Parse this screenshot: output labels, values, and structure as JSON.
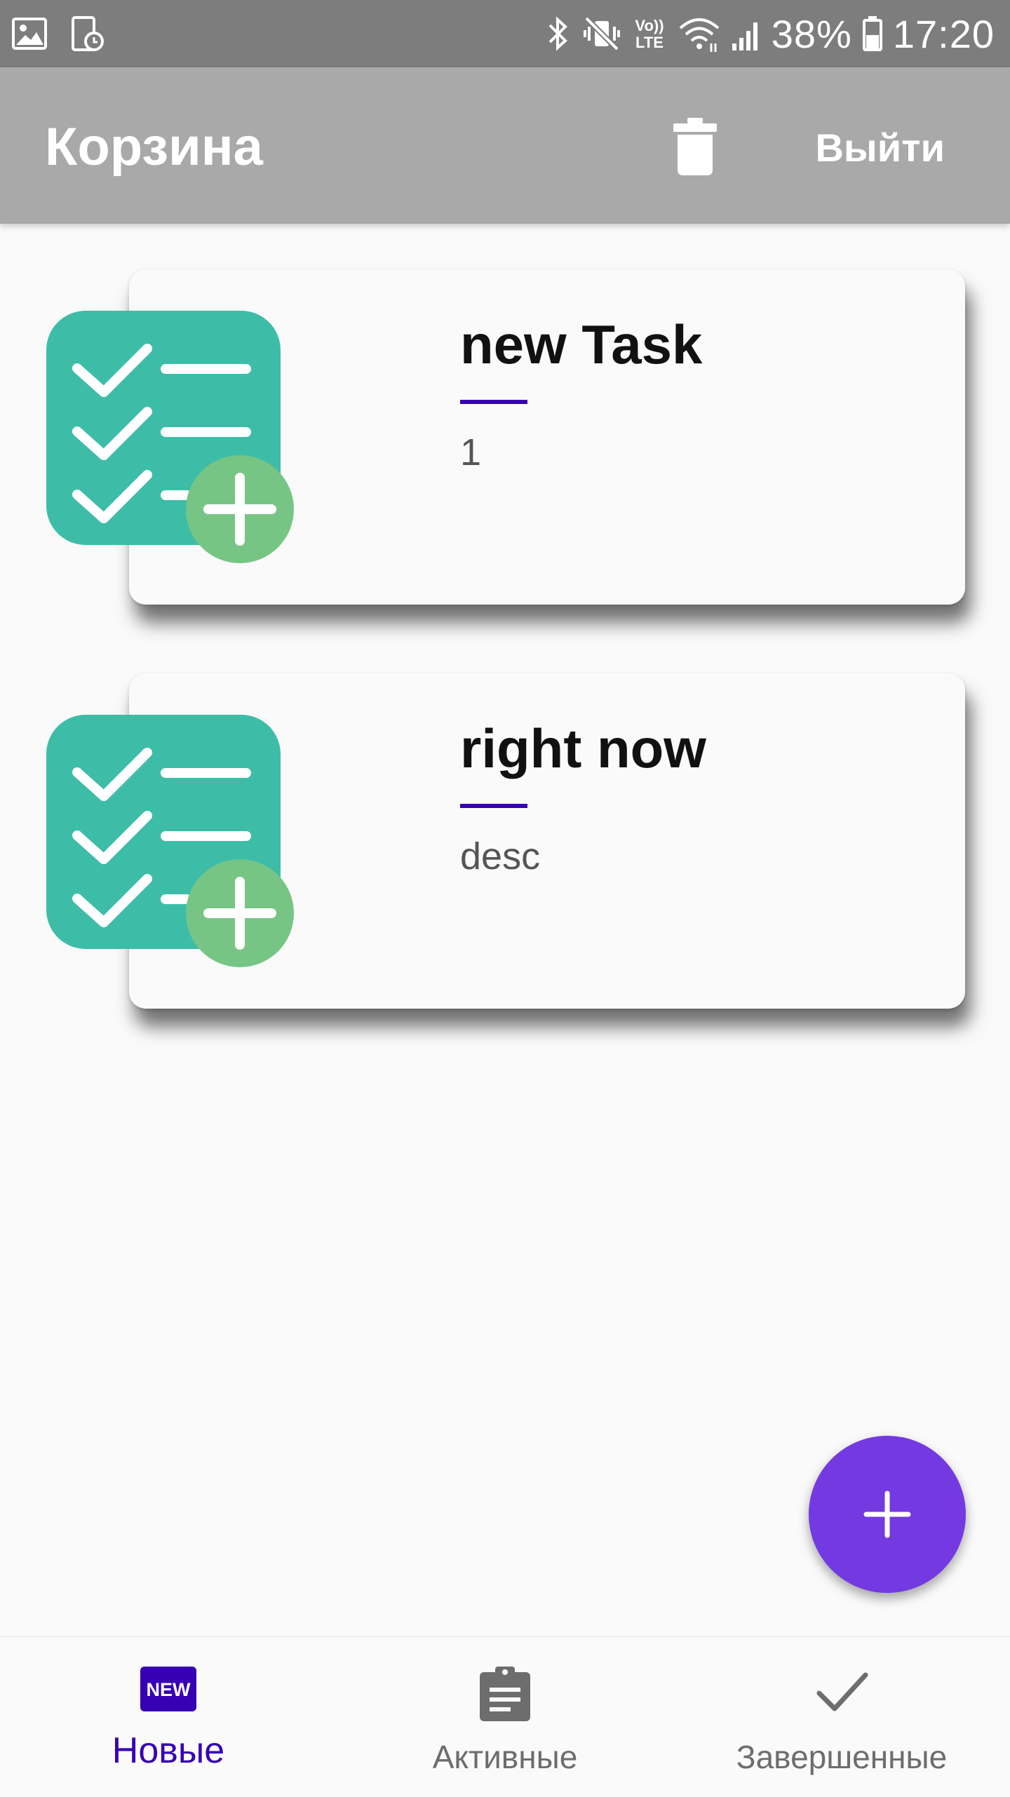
{
  "status_bar": {
    "battery_percent": "38%",
    "time": "17:20",
    "left_icons": [
      "image-icon",
      "screenshot-icon"
    ],
    "right_icons": [
      "bluetooth-icon",
      "vibrate-mute-icon",
      "volte-icon",
      "wifi-icon",
      "signal-icon",
      "battery-icon"
    ],
    "volte_label": "Vo)) LTE"
  },
  "app_bar": {
    "title": "Корзина",
    "delete_icon": "trash-icon",
    "logout_label": "Выйти"
  },
  "tasks": [
    {
      "title": "new Task",
      "description": "1",
      "icon": "checklist-add-icon"
    },
    {
      "title": "right now",
      "description": "desc",
      "icon": "checklist-add-icon"
    }
  ],
  "fab": {
    "icon": "plus-icon"
  },
  "bottom_nav": {
    "items": [
      {
        "label": "Новые",
        "icon": "new-icon",
        "badge_text": "NEW",
        "active": true
      },
      {
        "label": "Активные",
        "icon": "clipboard-icon",
        "active": false
      },
      {
        "label": "Завершенные",
        "icon": "check-icon",
        "active": false
      }
    ]
  },
  "colors": {
    "status_bar": "#7d7d7d",
    "app_bar": "#a9a9a9",
    "accent": "#3700b3",
    "fab": "#7439e0",
    "icon_teal": "#3dbda7",
    "icon_green": "#77c585"
  }
}
